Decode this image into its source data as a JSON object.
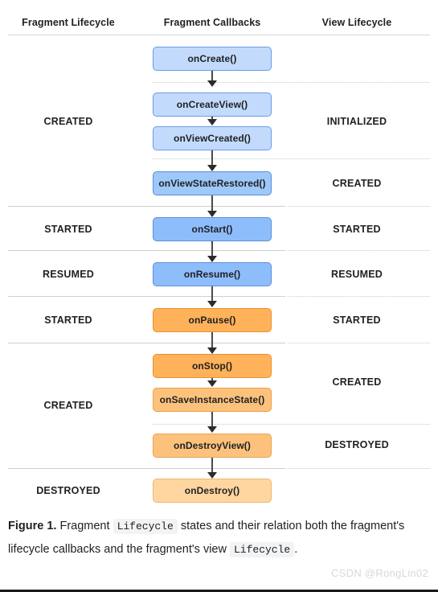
{
  "figure": {
    "columns": [
      {
        "key": "fragment_lifecycle",
        "label": "Fragment Lifecycle"
      },
      {
        "key": "fragment_callbacks",
        "label": "Fragment Callbacks"
      },
      {
        "key": "view_lifecycle",
        "label": "View Lifecycle"
      }
    ],
    "callbacks": [
      {
        "label": "onCreate()",
        "color": "#c2dbfc",
        "border": "#6b9ae8"
      },
      {
        "label": "onCreateView()",
        "color": "#c2dbfc",
        "border": "#6b9ae8"
      },
      {
        "label": "onViewCreated()",
        "color": "#c2dbfc",
        "border": "#6b9ae8"
      },
      {
        "label": "onViewStateRestored()",
        "color": "#9ec8fa",
        "border": "#5b8fd8"
      },
      {
        "label": "onStart()",
        "color": "#8ebdfc",
        "border": "#5b8fd8"
      },
      {
        "label": "onResume()",
        "color": "#8ebdfc",
        "border": "#5b8fd8"
      },
      {
        "label": "onPause()",
        "color": "#ffb259",
        "border": "#e8922f"
      },
      {
        "label": "onStop()",
        "color": "#ffb259",
        "border": "#e8922f"
      },
      {
        "label": "onSaveInstanceState()",
        "color": "#fcc27c",
        "border": "#e8a24f"
      },
      {
        "label": "onDestroyView()",
        "color": "#fcc27c",
        "border": "#e8a24f"
      },
      {
        "label": "onDestroy()",
        "color": "#ffd6a0",
        "border": "#e8b76f"
      }
    ],
    "fragment_states": [
      {
        "label": "CREATED"
      },
      {
        "label": "STARTED"
      },
      {
        "label": "RESUMED"
      },
      {
        "label": "STARTED"
      },
      {
        "label": "CREATED"
      },
      {
        "label": "DESTROYED"
      }
    ],
    "view_states": [
      {
        "label": "INITIALIZED"
      },
      {
        "label": "CREATED"
      },
      {
        "label": "STARTED"
      },
      {
        "label": "RESUMED"
      },
      {
        "label": "STARTED"
      },
      {
        "label": "CREATED"
      },
      {
        "label": "DESTROYED"
      }
    ]
  },
  "caption": {
    "figure_label": "Figure 1.",
    "text_1": "Fragment",
    "code_1": "Lifecycle",
    "text_2": "states and their relation both the fragment's lifecycle callbacks and the fragment's view",
    "code_2": "Lifecycle",
    "text_3": "."
  },
  "watermark": {
    "text": "CSDN @RongLin02"
  }
}
